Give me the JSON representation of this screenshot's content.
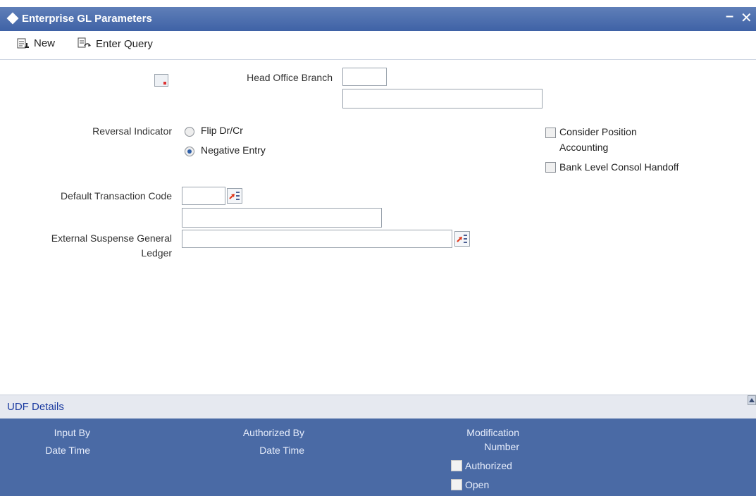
{
  "window": {
    "title": "Enterprise GL Parameters",
    "minimize": "–",
    "close": "✕"
  },
  "toolbar": {
    "new_label": "New",
    "enter_query_label": "Enter Query"
  },
  "form": {
    "head_office_branch_label": "Head Office Branch",
    "head_office_branch_code": "",
    "head_office_branch_desc": "",
    "reversal_indicator_label": "Reversal Indicator",
    "reversal_options": [
      {
        "label": "Flip Dr/Cr",
        "selected": false
      },
      {
        "label": "Negative Entry",
        "selected": true
      }
    ],
    "consider_position_label_line1": "Consider Position",
    "consider_position_label_line2": "Accounting",
    "consider_position_checked": false,
    "bank_level_consol_label": "Bank Level Consol Handoff",
    "bank_level_consol_checked": false,
    "default_txn_code_label": "Default Transaction Code",
    "default_txn_code_value": "",
    "default_txn_code_desc": "",
    "ext_suspense_label_line1": "External Suspense General",
    "ext_suspense_label_line2": "Ledger",
    "ext_suspense_value": ""
  },
  "udf": {
    "label": "UDF Details"
  },
  "footer": {
    "input_by": "Input By",
    "input_date_time": "Date Time",
    "authorized_by": "Authorized By",
    "auth_date_time": "Date Time",
    "modification_line1": "Modification",
    "modification_line2": "Number",
    "authorized_label": "Authorized",
    "open_label": "Open"
  },
  "colors": {
    "titlebar": "#3f62a6",
    "footer": "#4a6aa5",
    "udf_link": "#1a3aa0"
  }
}
